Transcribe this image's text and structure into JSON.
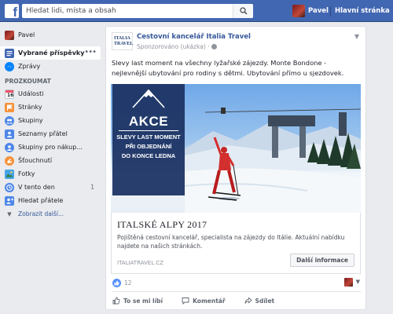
{
  "topbar": {
    "logo": "f",
    "search_placeholder": "Hledat lidi, místa a obsah",
    "user_name": "Pavel",
    "home_label": "Hlavní stránka"
  },
  "sidebar": {
    "user_name": "Pavel",
    "items": [
      {
        "label": "Vybrané příspěvky",
        "icon": "news-feed-icon",
        "active": true
      },
      {
        "label": "Zprávy",
        "icon": "messenger-icon"
      }
    ],
    "section_title": "PROZKOUMAT",
    "explore": [
      {
        "label": "Události",
        "icon": "calendar-icon"
      },
      {
        "label": "Stránky",
        "icon": "pages-flag-icon"
      },
      {
        "label": "Skupiny",
        "icon": "groups-icon"
      },
      {
        "label": "Seznamy přátel",
        "icon": "friend-lists-icon"
      },
      {
        "label": "Skupiny pro nákup...",
        "icon": "buy-sell-groups-icon"
      },
      {
        "label": "Šťouchnutí",
        "icon": "pokes-icon"
      },
      {
        "label": "Fotky",
        "icon": "photos-icon"
      },
      {
        "label": "V tento den",
        "icon": "on-this-day-icon",
        "count": "1"
      },
      {
        "label": "Hledat přátele",
        "icon": "find-friends-icon"
      }
    ],
    "more_label": "Zobrazit další..."
  },
  "post": {
    "page_logo_line1": "ITALIA",
    "page_logo_line2": "TRAVEL",
    "page_name": "Cestovní kancelář Italia Travel",
    "sponsored": "Sponzorováno (ukázka) ·",
    "text": "Slevy last moment na všechny lyžařské zájezdy. Monte Bondone - nejlevnější ubytování pro rodiny s dětmi. Ubytování přímo u sjezdovek.",
    "ad_image": {
      "akce": "AKCE",
      "line1": "SLEVY LAST MOMENT",
      "line2": "PŘI OBJEDNÁNÍ",
      "line3": "DO KONCE LEDNA"
    },
    "headline": "ITALSKÉ ALPY 2017",
    "description": "Pojištěná cestovní kancelář, specialista na zájezdy do Itálie. Aktuální nabídku najdete na našich stránkách.",
    "url": "ITALIATRAVEL.CZ",
    "cta": "Další informace",
    "like_count": "12",
    "actions": {
      "like": "To se mi líbí",
      "comment": "Komentář",
      "share": "Sdílet"
    }
  },
  "colors": {
    "brand": "#4267b2",
    "link": "#365899",
    "background": "#e9ebee"
  }
}
